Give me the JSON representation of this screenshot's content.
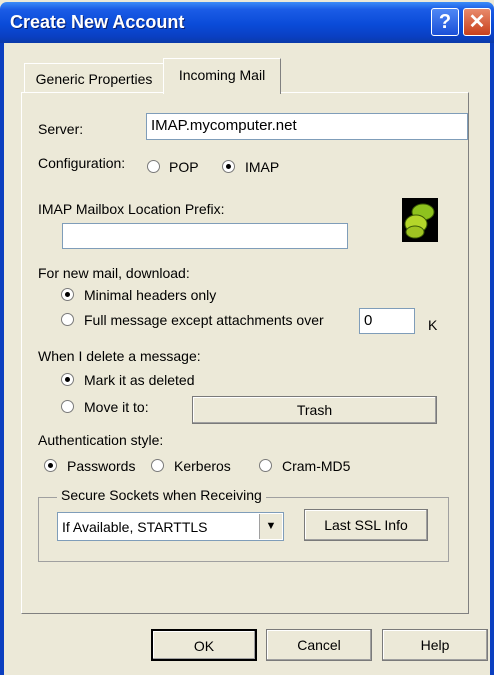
{
  "window": {
    "title": "Create New Account",
    "help_glyph": "?",
    "close_glyph": "✕"
  },
  "tabs": [
    {
      "label": "Generic Properties",
      "active": false
    },
    {
      "label": "Incoming Mail",
      "active": true
    }
  ],
  "server": {
    "label": "Server:",
    "value": "IMAP.mycomputer.net"
  },
  "configuration": {
    "label": "Configuration:",
    "options": [
      "POP",
      "IMAP"
    ],
    "selected": "IMAP"
  },
  "mailbox_prefix": {
    "label": "IMAP Mailbox Location Prefix:",
    "value": ""
  },
  "download": {
    "label": "For new mail, download:",
    "options": [
      "Minimal headers only",
      "Full message except attachments over"
    ],
    "selected": "Minimal headers only",
    "size_value": "0",
    "size_unit": "K"
  },
  "delete": {
    "label": "When I delete a message:",
    "options": [
      "Mark it as deleted",
      "Move it to:"
    ],
    "selected": "Mark it as deleted",
    "folder_button": "Trash"
  },
  "authentication": {
    "label": "Authentication style:",
    "options": [
      "Passwords",
      "Kerberos",
      "Cram-MD5"
    ],
    "selected": "Passwords"
  },
  "ssl": {
    "legend": "Secure Sockets when Receiving",
    "selected": "If Available, STARTTLS",
    "info_button": "Last SSL Info"
  },
  "footer": {
    "ok": "OK",
    "cancel": "Cancel",
    "help": "Help"
  },
  "icons": [
    "help-icon",
    "close-icon",
    "imap-mailbox-icon",
    "chevron-down-icon"
  ],
  "colors": {
    "titlebar": "#0a4bd8",
    "face": "#ece9d8",
    "field_border": "#7f9db9"
  }
}
